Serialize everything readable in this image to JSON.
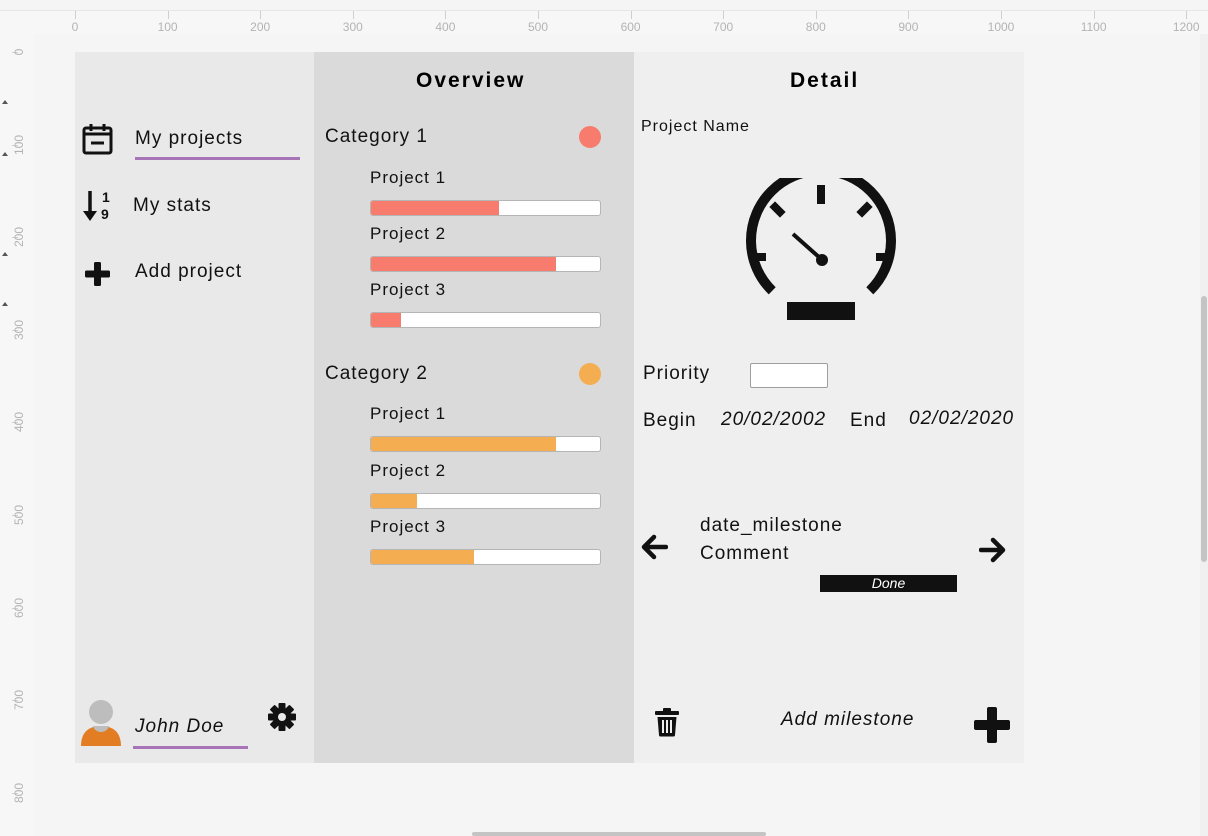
{
  "ruler": {
    "top": [
      "0",
      "100",
      "200",
      "300",
      "400",
      "500",
      "600",
      "700",
      "800",
      "900",
      "1000",
      "1100",
      "1200"
    ],
    "left": [
      "0",
      "100",
      "200",
      "300",
      "400",
      "500",
      "600",
      "700",
      "800"
    ]
  },
  "sidebar": {
    "items": [
      {
        "label": "My projects",
        "icon": "calendar-icon"
      },
      {
        "label": "My stats",
        "icon": "sort-numeric-icon"
      },
      {
        "label": "Add project",
        "icon": "plus-icon"
      }
    ],
    "user": {
      "name": "John Doe",
      "avatar_icon": "user-avatar-icon",
      "settings_icon": "gear-icon"
    }
  },
  "overview": {
    "title": "Overview",
    "categories": [
      {
        "label": "Category 1",
        "color": "#f87c6d",
        "projects": [
          {
            "label": "Project 1",
            "progress": 0.56
          },
          {
            "label": "Project 2",
            "progress": 0.81
          },
          {
            "label": "Project 3",
            "progress": 0.13
          }
        ]
      },
      {
        "label": "Category 2",
        "color": "#f4ad50",
        "projects": [
          {
            "label": "Project 1",
            "progress": 0.81
          },
          {
            "label": "Project 2",
            "progress": 0.2
          },
          {
            "label": "Project 3",
            "progress": 0.45
          }
        ]
      }
    ]
  },
  "detail": {
    "title": "Detail",
    "project_name": "Project Name",
    "gauge_icon": "speedometer-icon",
    "priority_label": "Priority",
    "priority_value": "",
    "begin_label": "Begin",
    "begin_date": "20/02/2002",
    "end_label": "End",
    "end_date": "02/02/2020",
    "milestone": {
      "date": "date_milestone",
      "comment": "Comment",
      "status": "Done"
    },
    "add_milestone_label": "Add milestone"
  },
  "colors": {
    "accent_underline": "#a874b8"
  }
}
